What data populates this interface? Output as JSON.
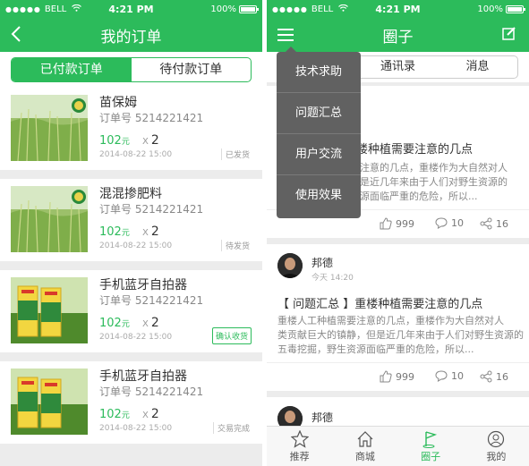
{
  "status_bar": {
    "carrier": "BELL",
    "time": "4:21 PM",
    "battery": "100%",
    "battery_level": 1.0
  },
  "left": {
    "nav": {
      "title": "我的订单"
    },
    "segments": [
      "已付款订单",
      "待付款订单"
    ],
    "orders": [
      {
        "name": "苗保姆",
        "order_no": "订单号 5214221421",
        "price": "102",
        "unit": "元",
        "qty": "2",
        "date": "2014-08-22  15:00",
        "status": "已发货"
      },
      {
        "name": "混混掺肥料",
        "order_no": "订单号 5214221421",
        "price": "102",
        "unit": "元",
        "qty": "2",
        "date": "2014-08-22  15:00",
        "status": "待发货"
      },
      {
        "name": "手机蓝牙自拍器",
        "order_no": "订单号 5214221421",
        "price": "102",
        "unit": "元",
        "qty": "2",
        "date": "2014-08-22  15:00",
        "status": "确认收货"
      },
      {
        "name": "手机蓝牙自拍器",
        "order_no": "订单号 5214221421",
        "price": "102",
        "unit": "元",
        "qty": "2",
        "date": "2014-08-22  15:00",
        "status": "交易完成"
      }
    ],
    "qty_prefix": "X"
  },
  "right": {
    "nav": {
      "title": "圈子"
    },
    "tabs": [
      "通讯录",
      "消息"
    ],
    "menu": [
      "技术求助",
      "问题汇总",
      "用户交流",
      "使用效果"
    ],
    "post1": {
      "title_fragment": "楼种植需要注意的几点",
      "body": [
        "注意的几点，重楼作为大自然对人",
        "是近几年来由于人们对野生资源的",
        "源面临严重的危险，所以..."
      ],
      "likes": "999",
      "comments": "10",
      "shares": "16"
    },
    "post2": {
      "user": "邦德",
      "time": "今天 14:20",
      "title": "【 问题汇总 】重楼种植需要注意的几点",
      "body": [
        "重楼人工种植需要注意的几点，重楼作为大自然对人",
        "类贡献巨大的镇静，但是近几年来由于人们对野生资源的",
        "五毒挖掘，野生资源面临严重的危险，所以..."
      ],
      "likes": "999",
      "comments": "10",
      "shares": "16"
    },
    "post3": {
      "user": "邦德"
    },
    "tabbar": [
      {
        "label": "推荐",
        "icon": "star-icon"
      },
      {
        "label": "商城",
        "icon": "home-icon"
      },
      {
        "label": "圈子",
        "icon": "flag-icon",
        "active": true
      },
      {
        "label": "我的",
        "icon": "user-icon"
      }
    ]
  },
  "colors": {
    "brand": "#2cbb5b",
    "menu_bg": "#616161"
  }
}
